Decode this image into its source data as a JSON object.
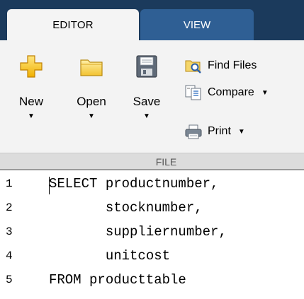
{
  "tabs": {
    "editor": "EDITOR",
    "view": "VIEW"
  },
  "toolbar": {
    "new_label": "New",
    "open_label": "Open",
    "save_label": "Save",
    "find_files_label": "Find Files",
    "compare_label": "Compare",
    "print_label": "Print",
    "dropdown_glyph": "▼",
    "section_label": "FILE"
  },
  "editor": {
    "lines": [
      {
        "number": "1",
        "text": "SELECT productnumber,"
      },
      {
        "number": "2",
        "text": "       stocknumber,"
      },
      {
        "number": "3",
        "text": "       suppliernumber,"
      },
      {
        "number": "4",
        "text": "       unitcost"
      },
      {
        "number": "5",
        "text": "FROM producttable"
      }
    ]
  },
  "colors": {
    "tab_strip": "#1b3a5c",
    "active_tab": "#f4f4f4",
    "inactive_tab": "#2f5f94",
    "toolstrip": "#f3f3f3",
    "section_bar": "#dcdcdc"
  },
  "icons": {
    "new": "plus-icon",
    "open": "folder-icon",
    "save": "floppy-disk-icon",
    "find_files": "find-files-icon",
    "compare": "compare-icon",
    "print": "printer-icon"
  }
}
